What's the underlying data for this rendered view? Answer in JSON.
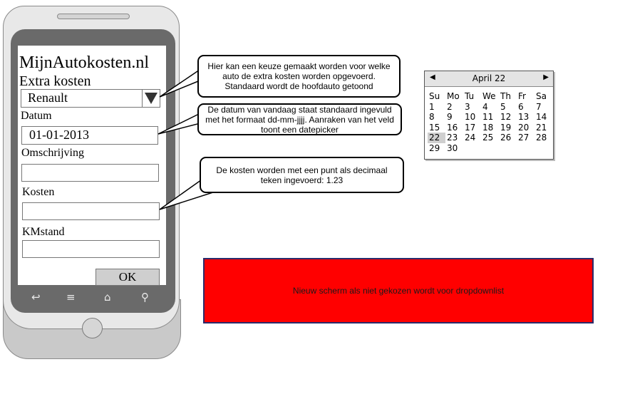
{
  "app": {
    "title": "MijnAutokosten.nl",
    "subtitle": "Extra kosten"
  },
  "form": {
    "car_select": {
      "value": "Renault"
    },
    "date_label": "Datum",
    "date_value": "01-01-2013",
    "description_label": "Omschrijving",
    "description_value": "",
    "cost_label": "Kosten",
    "cost_value": "",
    "km_label": "KMstand",
    "km_value": "",
    "ok_label": "OK"
  },
  "nav_icons": [
    "back-icon",
    "menu-icon",
    "home-icon",
    "search-icon"
  ],
  "callouts": {
    "car": "Hier kan een keuze gemaakt worden voor welke auto de extra kosten worden opgevoerd. Standaard wordt de hoofdauto getoond",
    "date": "De datum van vandaag staat standaard ingevuld met het formaat dd-mm-jjjj. Aanraken van het veld toont een datepicker",
    "cost": "De kosten worden met een punt als decimaal teken ingevoerd: 1.23"
  },
  "calendar": {
    "month_label": "April 22",
    "prev": "◀",
    "next": "▶",
    "weekdays": [
      "Su",
      "Mo",
      "Tu",
      "We",
      "Th",
      "Fr",
      "Sa"
    ],
    "days": [
      "1",
      "2",
      "3",
      "4",
      "5",
      "6",
      "7",
      "8",
      "9",
      "10",
      "11",
      "12",
      "13",
      "14",
      "15",
      "16",
      "17",
      "18",
      "19",
      "20",
      "21",
      "22",
      "23",
      "24",
      "25",
      "26",
      "27",
      "28",
      "29",
      "30"
    ],
    "selected_day": "22"
  },
  "note": {
    "text": "Nieuw scherm als niet gekozen wordt voor dropdownlist",
    "color": "#ff0000"
  }
}
